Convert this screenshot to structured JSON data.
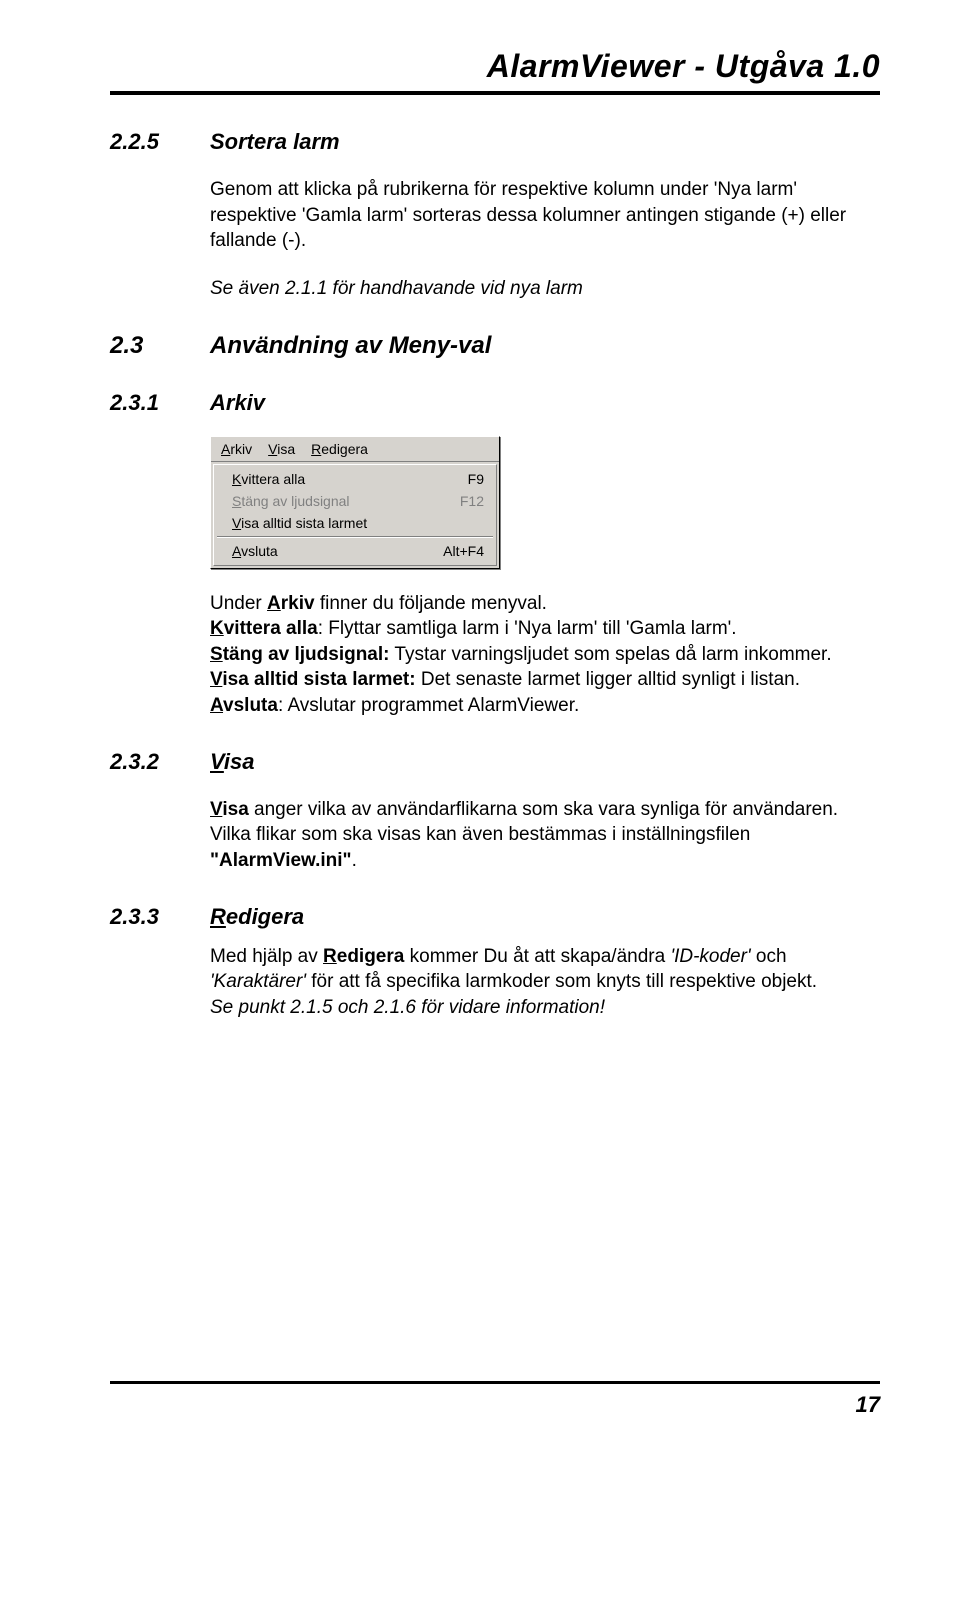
{
  "header": {
    "title": "AlarmViewer  -  Utgåva 1.0"
  },
  "s225": {
    "num": "2.2.5",
    "title": "Sortera larm",
    "para": "Genom att klicka på rubrikerna för respektive kolumn under 'Nya larm' respektive 'Gamla larm' sorteras dessa kolumner antingen stigande (+) eller fallande (-).",
    "see": "Se även 2.1.1 för handhavande vid nya larm"
  },
  "s23": {
    "num": "2.3",
    "title": "Användning av Meny-val"
  },
  "s231": {
    "num": "2.3.1",
    "title": "Arkiv",
    "menubar": {
      "arkiv": {
        "mn": "A",
        "rest": "rkiv"
      },
      "visa": {
        "mn": "V",
        "rest": "isa"
      },
      "redigera": {
        "mn": "R",
        "rest": "edigera"
      }
    },
    "menu_items": {
      "kvittera": {
        "mn": "K",
        "rest": "vittera alla",
        "shortcut": "F9"
      },
      "stang": {
        "mn": "S",
        "rest": "täng av ljudsignal",
        "shortcut": "F12"
      },
      "visa": {
        "mn": "V",
        "rest": "isa alltid sista larmet",
        "shortcut": ""
      },
      "avsluta": {
        "mn": "A",
        "rest": "vsluta",
        "shortcut": "Alt+F4"
      }
    },
    "intro_pre": "Under ",
    "intro_mn": "A",
    "intro_rest": "rkiv",
    "intro_post": " finner du följande menyval.",
    "lines": {
      "k_mn": "K",
      "k_rest": "vittera alla",
      "k_desc": ": Flyttar samtliga larm i 'Nya larm' till 'Gamla larm'.",
      "s_mn": "S",
      "s_rest": "täng av ljudsignal:",
      "s_desc": " Tystar varningsljudet som spelas då larm inkommer.",
      "v_mn": "V",
      "v_rest": "isa alltid sista larmet:",
      "v_desc": " Det senaste larmet ligger alltid synligt i listan.",
      "a_mn": "A",
      "a_rest": "vsluta",
      "a_desc": ": Avslutar programmet AlarmViewer."
    }
  },
  "s232": {
    "num": "2.3.2",
    "title_mn": "V",
    "title_rest": "isa",
    "para_mn": "V",
    "para_rest": "isa",
    "para_tail": " anger vilka av användarflikarna som ska vara synliga för användaren. Vilka flikar som ska visas kan även bestämmas i inställningsfilen ",
    "file": "\"AlarmView.ini\"",
    "dot": "."
  },
  "s233": {
    "num": "2.3.3",
    "title_mn": "R",
    "title_rest": "edigera",
    "para_pre": "Med hjälp av ",
    "para_mn": "R",
    "para_rest": "edigera",
    "para_mid": " kommer Du åt att skapa/ändra ",
    "idk": "'ID-koder'",
    "and": " och ",
    "kar": "'Karaktärer'",
    "para_tail": " för att få specifika larmkoder som knyts till respektive objekt.",
    "see": "Se punkt 2.1.5 och 2.1.6 för vidare information!"
  },
  "page_number": "17"
}
